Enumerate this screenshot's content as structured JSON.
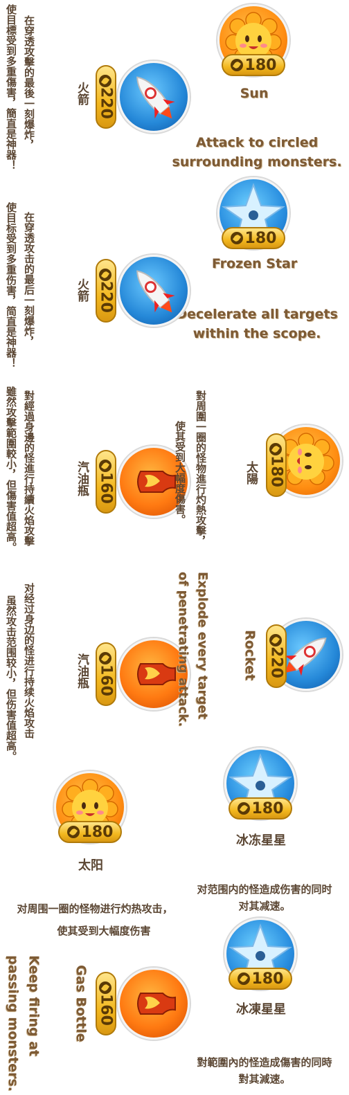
{
  "icons": {
    "sun": "sun-icon",
    "star": "frozen-star-icon",
    "rocket": "rocket-icon",
    "gas": "gas-bottle-icon",
    "coin": "carrot-coin-icon"
  },
  "colors": {
    "badge_gold": "#f3b81f",
    "label_brown": "#7d5a34",
    "text_dark": "#5b4633"
  },
  "items": {
    "sun_top": {
      "cost": "180",
      "name": "Sun",
      "desc": "Attack to circled\nsurrounding monsters."
    },
    "star_top": {
      "cost": "180",
      "name": "Frozen Star",
      "desc": "Decelerate all targets\nwithin the scope."
    },
    "rocket_1": {
      "cost": "220",
      "name": "火箭",
      "desc_a": "在穿透攻擊的最後一刻爆炸，",
      "desc_b": "使目標受到多重傷害，簡直是神器！"
    },
    "rocket_2": {
      "cost": "220",
      "name": "火箭",
      "desc_a": "在穿透攻击的最后一刻爆炸，",
      "desc_b": "使目标受到多重伤害，简直是神器！"
    },
    "gas_1": {
      "cost": "160",
      "name": "汽油瓶",
      "desc_a": "對經過身邊的怪進行持續火焰攻擊",
      "desc_b": "雖然攻擊範圍較小，但傷害值超高。"
    },
    "gas_2": {
      "cost": "160",
      "name": "汽油瓶",
      "desc_a": "对经过身边的怪进行持续火焰攻击",
      "desc_b": "虽然攻击范围较小，但伤害值超高。"
    },
    "sun_tw": {
      "cost": "180",
      "name": "太陽",
      "desc_a": "對周圍一圈的怪物進行灼熱攻擊，",
      "desc_b": "使其受到大幅度傷害。"
    },
    "rocket_en": {
      "cost": "220",
      "name": "Rocket",
      "desc": "Explode every target\nof penetrating attack."
    },
    "star_cn": {
      "cost": "180",
      "name": "冰冻星星"
    },
    "sun_cn": {
      "cost": "180",
      "name": "太阳"
    },
    "sun_cn_desc": {
      "line1": "对周围一圈的怪物进行灼热攻击，",
      "line2": "使其受到大幅度伤害"
    },
    "star_cn_desc": {
      "line1": "对范围内的怪造成伤害的同时",
      "line2": "对其减速。"
    },
    "gas_en": {
      "cost": "160",
      "name": "Gas Bottle",
      "desc": "Keep firing at\npassing monsters."
    },
    "star_tw": {
      "cost": "180",
      "name": "冰凍星星"
    },
    "star_tw_desc": {
      "line1": "對範圍內的怪造成傷害的同時",
      "line2": "對其減速。"
    }
  }
}
